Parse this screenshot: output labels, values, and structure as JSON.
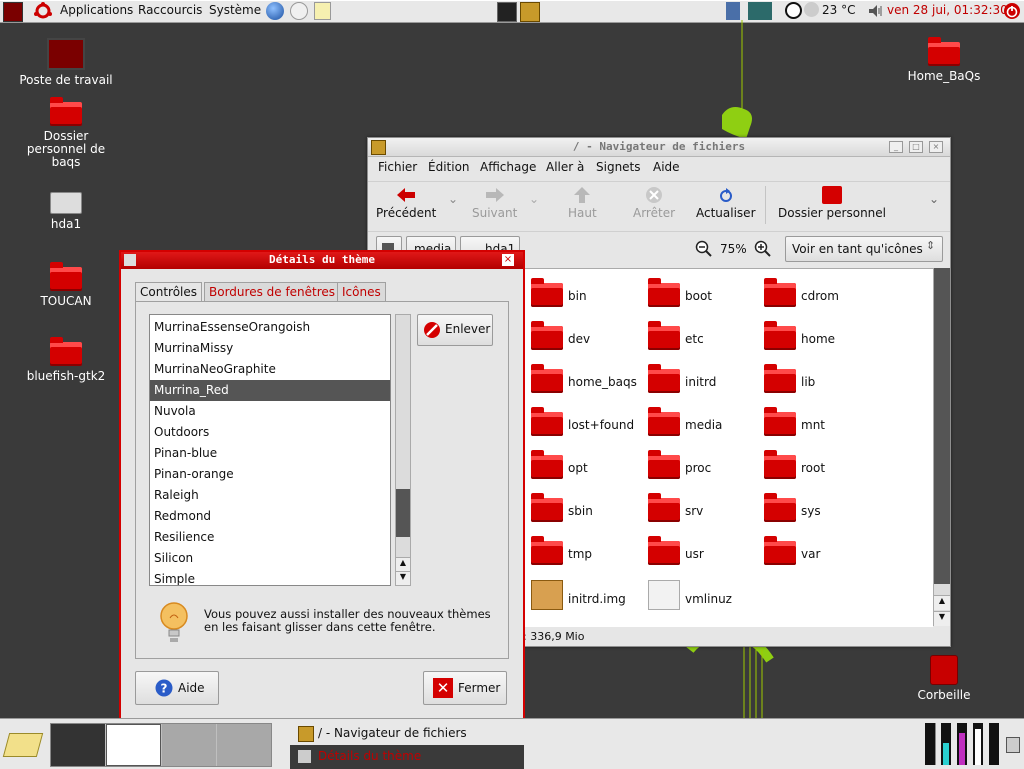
{
  "top_panel": {
    "menus": [
      "Applications",
      "Raccourcis",
      "Système"
    ],
    "temperature": "23 °C",
    "clock": "ven 28 jui, 01:32:30"
  },
  "desktop_icons": {
    "left": [
      "Poste de travail",
      "Dossier personnel de baqs",
      "hda1",
      "TOUCAN",
      "bluefish-gtk2"
    ],
    "right_top": "Home_BaQs",
    "trash": "Corbeille"
  },
  "file_manager": {
    "title": "/ - Navigateur de fichiers",
    "menus": [
      "Fichier",
      "Édition",
      "Affichage",
      "Aller à",
      "Signets",
      "Aide"
    ],
    "toolbar": {
      "back": "Précédent",
      "forward": "Suivant",
      "up": "Haut",
      "stop": "Arrêter",
      "reload": "Actualiser",
      "home": "Dossier personnel"
    },
    "path_buttons": [
      "media",
      "hda1"
    ],
    "zoom": "75%",
    "view_mode": "Voir en tant qu'icônes",
    "items": [
      "bin",
      "boot",
      "cdrom",
      "dev",
      "etc",
      "home",
      "home_baqs",
      "initrd",
      "lib",
      "lost+found",
      "media",
      "mnt",
      "opt",
      "proc",
      "root",
      "sbin",
      "srv",
      "sys",
      "tmp",
      "usr",
      "var",
      "initrd.img",
      "vmlinuz"
    ],
    "status": ": 336,9 Mio"
  },
  "theme_dialog": {
    "title": "Détails du thème",
    "tabs": [
      "Contrôles",
      "Bordures de fenêtres",
      "Icônes"
    ],
    "themes": [
      "MurrinaEssenseOrangoish",
      "MurrinaMissy",
      "MurrinaNeoGraphite",
      "Murrina_Red",
      "Nuvola",
      "Outdoors",
      "Pinan-blue",
      "Pinan-orange",
      "Raleigh",
      "Redmond",
      "Resilience",
      "Silicon",
      "Simple"
    ],
    "selected": "Murrina_Red",
    "remove_button": "Enlever",
    "hint": "Vous pouvez aussi installer des nouveaux thèmes en les faisant glisser dans cette fenêtre.",
    "help_button": "Aide",
    "close_button": "Fermer"
  },
  "taskbar": {
    "tasks": [
      "/ - Navigateur de fichiers",
      "Détails du thème"
    ]
  }
}
